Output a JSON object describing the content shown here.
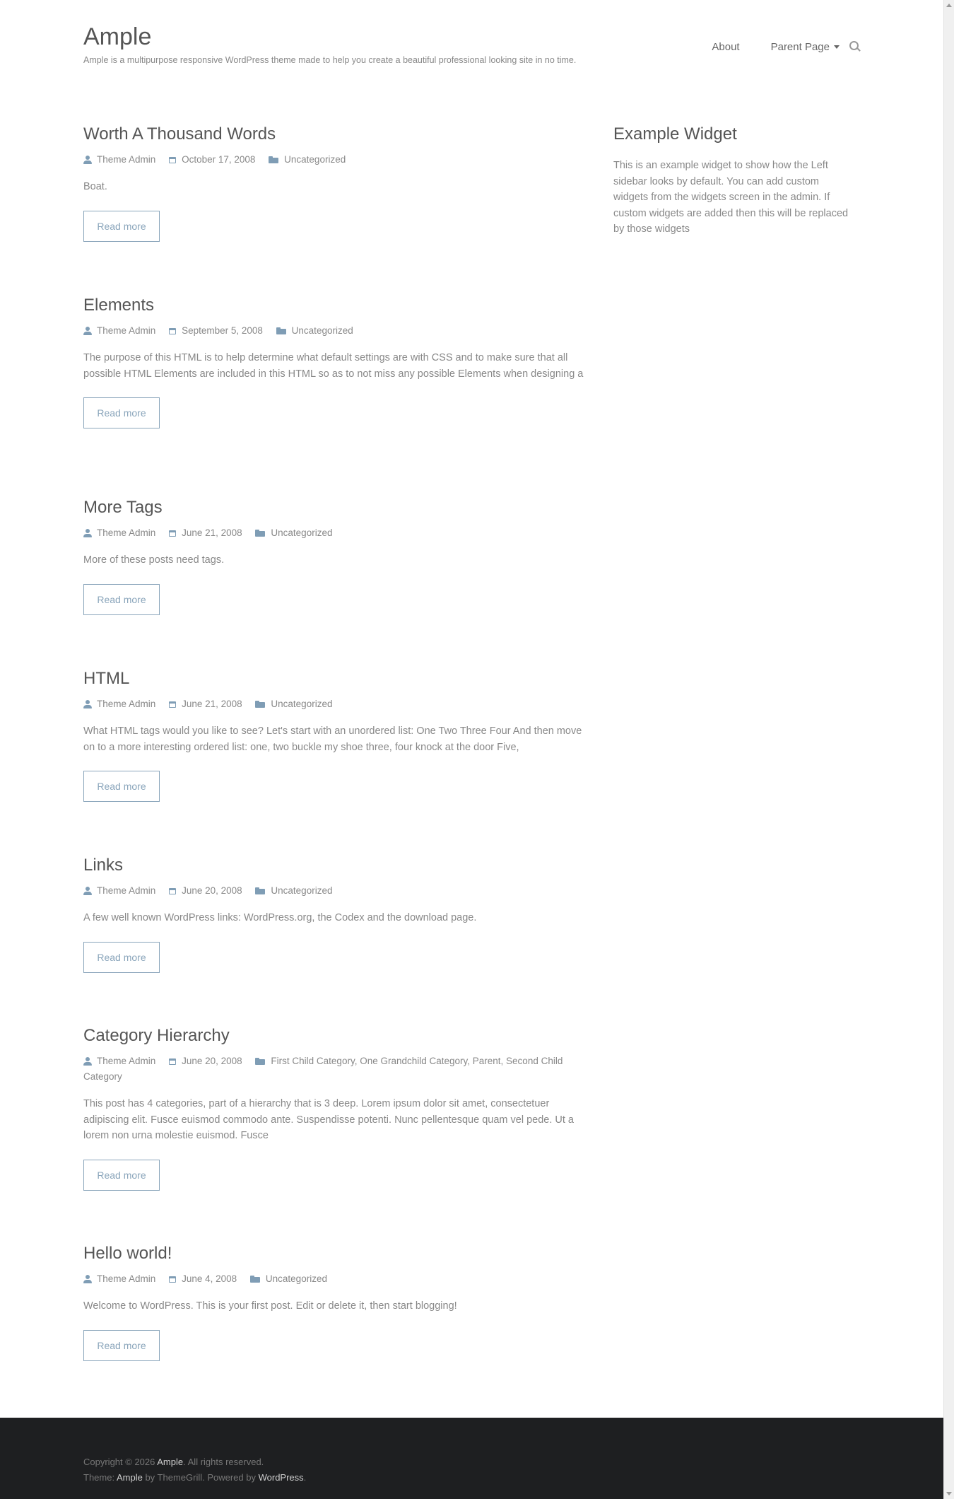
{
  "site": {
    "title": "Ample",
    "tagline": "Ample is a multipurpose responsive WordPress theme made to help you create a beautiful professional looking site in no time."
  },
  "nav": {
    "items": [
      {
        "label": "About"
      },
      {
        "label": "Parent Page"
      }
    ]
  },
  "read_more_label": "Read more",
  "posts": [
    {
      "title": "Worth A Thousand Words",
      "author": "Theme Admin",
      "date": "October 17, 2008",
      "categories": "Uncategorized",
      "excerpt": "Boat."
    },
    {
      "title": "Elements",
      "author": "Theme Admin",
      "date": "September 5, 2008",
      "categories": "Uncategorized",
      "excerpt": "The purpose of this HTML is to help determine what default settings are with CSS and to make sure that all possible HTML Elements are included in this HTML so as to not miss any possible Elements when designing a"
    },
    {
      "title": "More Tags",
      "author": "Theme Admin",
      "date": "June 21, 2008",
      "categories": "Uncategorized",
      "excerpt": "More of these posts need tags."
    },
    {
      "title": "HTML",
      "author": "Theme Admin",
      "date": "June 21, 2008",
      "categories": "Uncategorized",
      "excerpt": "What HTML tags would you like to see? Let's start with an unordered list: One Two Three Four And then move on to a more interesting ordered list: one, two buckle my shoe three, four knock at the door Five,"
    },
    {
      "title": "Links",
      "author": "Theme Admin",
      "date": "June 20, 2008",
      "categories": "Uncategorized",
      "excerpt": "A few well known WordPress links: WordPress.org, the Codex and the download page."
    },
    {
      "title": "Category Hierarchy",
      "author": "Theme Admin",
      "date": "June 20, 2008",
      "categories": "First Child Category, One Grandchild Category, Parent, Second Child Category",
      "excerpt": "This post has 4 categories, part of a hierarchy that is 3 deep. Lorem ipsum dolor sit amet, consectetuer adipiscing elit. Fusce euismod commodo ante. Suspendisse potenti. Nunc pellentesque quam vel pede. Ut a lorem non urna molestie euismod. Fusce"
    },
    {
      "title": "Hello world!",
      "author": "Theme Admin",
      "date": "June 4, 2008",
      "categories": "Uncategorized",
      "excerpt": "Welcome to WordPress. This is your first post. Edit or delete it, then start blogging!"
    }
  ],
  "widget": {
    "title": "Example Widget",
    "text": "This is an example widget to show how the Left sidebar looks by default. You can add custom widgets from the widgets screen in the admin. If custom widgets are added then this will be replaced by those widgets"
  },
  "footer": {
    "copyright_prefix": "Copyright © 2026 ",
    "copyright_link": "Ample",
    "copyright_suffix": ". All rights reserved.",
    "theme_prefix": "Theme: ",
    "theme_link": "Ample",
    "theme_middle": " by ThemeGrill. Powered by ",
    "powered_link": "WordPress",
    "theme_suffix": "."
  },
  "colors": {
    "accent": "#8aa5bb",
    "icon": "#7f9db5",
    "footer_bg": "#1e1f21"
  }
}
